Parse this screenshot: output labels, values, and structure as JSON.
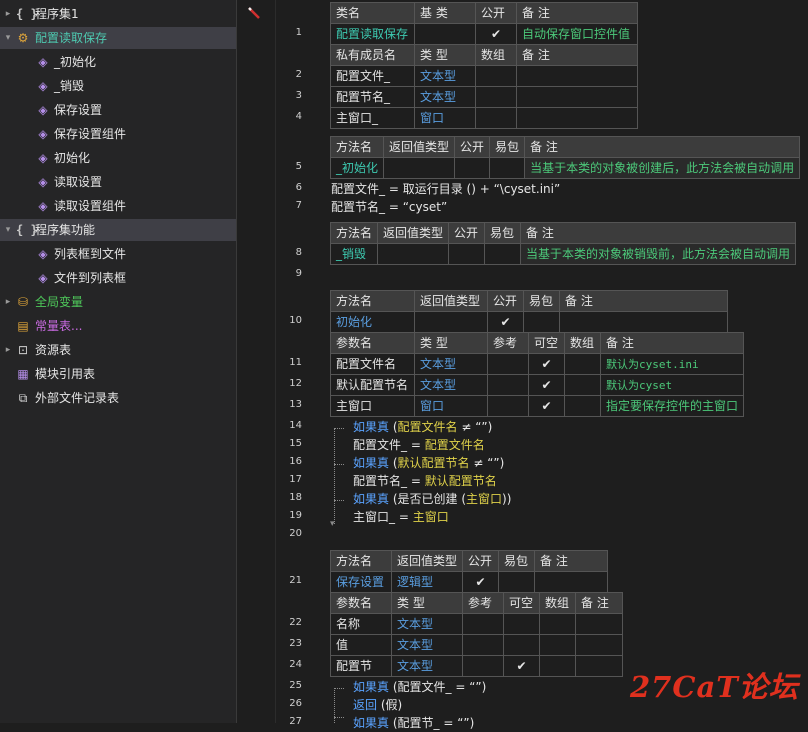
{
  "sidebar": {
    "items": [
      {
        "label": "程序集1",
        "icon": "braces-icon",
        "arrow": "›"
      },
      {
        "label": "配置读取保存",
        "icon": "gear-class-icon",
        "arrow": "⌄"
      },
      {
        "label": "_初始化",
        "icon": "cube-icon"
      },
      {
        "label": "_销毁",
        "icon": "cube-icon"
      },
      {
        "label": "保存设置",
        "icon": "cube-icon"
      },
      {
        "label": "保存设置组件",
        "icon": "cube-icon"
      },
      {
        "label": "初始化",
        "icon": "cube-icon"
      },
      {
        "label": "读取设置",
        "icon": "cube-icon"
      },
      {
        "label": "读取设置组件",
        "icon": "cube-icon"
      },
      {
        "label": "程序集功能",
        "icon": "braces-icon",
        "arrow": "⌄"
      },
      {
        "label": "列表框到文件",
        "icon": "cube-icon"
      },
      {
        "label": "文件到列表框",
        "icon": "cube-icon"
      },
      {
        "label": "全局变量",
        "icon": "database-icon",
        "arrow": "›"
      },
      {
        "label": "常量表...",
        "icon": "grid-icon"
      },
      {
        "label": "资源表",
        "icon": "resource-icon",
        "arrow": "›"
      },
      {
        "label": "模块引用表",
        "icon": "module-icon"
      },
      {
        "label": "外部文件记录表",
        "icon": "file-icon"
      }
    ]
  },
  "line_numbers": [
    "1",
    "2",
    "3",
    "4",
    "5",
    "6",
    "7",
    "8",
    "9",
    "10",
    "11",
    "12",
    "13",
    "14",
    "15",
    "16",
    "17",
    "18",
    "19",
    "20",
    "21",
    "22",
    "23",
    "24",
    "25",
    "26",
    "27"
  ],
  "class_table": {
    "headers": [
      "类名",
      "基 类",
      "公开",
      "备 注"
    ],
    "row": [
      "配置读取保存",
      "",
      "✔",
      "自动保存窗口控件值"
    ],
    "member_headers": [
      "私有成员名",
      "类 型",
      "数组",
      "备 注"
    ],
    "members": [
      [
        "配置文件_",
        "文本型",
        "",
        ""
      ],
      [
        "配置节名_",
        "文本型",
        "",
        ""
      ],
      [
        "主窗口_",
        "窗口",
        "",
        ""
      ]
    ]
  },
  "method_init_private": {
    "headers": [
      "方法名",
      "返回值类型",
      "公开",
      "易包",
      "备 注"
    ],
    "row": [
      "_初始化",
      "",
      "",
      "",
      "当基于本类的对象被创建后，此方法会被自动调用"
    ]
  },
  "code_line6": {
    "lhs": "配置文件_",
    "op": " = ",
    "fn": "取运行目录",
    "rest": " () + “\\cyset.ini”"
  },
  "code_line7": {
    "lhs": "配置节名_",
    "op": " = ",
    "rest": "“cyset”"
  },
  "method_destroy": {
    "headers": [
      "方法名",
      "返回值类型",
      "公开",
      "易包",
      "备 注"
    ],
    "row": [
      "_销毁",
      "",
      "",
      "",
      "当基于本类的对象被销毁前，此方法会被自动调用"
    ]
  },
  "method_init": {
    "headers": [
      "方法名",
      "返回值类型",
      "公开",
      "易包",
      "备 注"
    ],
    "row": [
      "初始化",
      "",
      "✔",
      "",
      ""
    ],
    "param_headers": [
      "参数名",
      "类 型",
      "参考",
      "可空",
      "数组",
      "备 注"
    ],
    "params": [
      [
        "配置文件名",
        "文本型",
        "",
        "✔",
        "",
        "默认为cyset.ini"
      ],
      [
        "默认配置节名",
        "文本型",
        "",
        "✔",
        "",
        "默认为cyset"
      ],
      [
        "主窗口",
        "窗口",
        "",
        "✔",
        "",
        "指定要保存控件的主窗口"
      ]
    ]
  },
  "code_block_init": {
    "l14": {
      "kw": "如果真",
      "a": " (",
      "v": "配置文件名",
      "b": " ≠ “”)"
    },
    "l15": {
      "lhs": "配置文件_",
      "op": " = ",
      "v": "配置文件名"
    },
    "l16": {
      "kw": "如果真",
      "a": " (",
      "v": "默认配置节名",
      "b": " ≠ “”)"
    },
    "l17": {
      "lhs": "配置节名_",
      "op": " = ",
      "v": "默认配置节名"
    },
    "l18": {
      "kw": "如果真",
      "a": " (",
      "fn": "是否已创建",
      "c": " (",
      "v": "主窗口",
      "b": "))"
    },
    "l19": {
      "lhs": "主窗口_",
      "op": " = ",
      "v": "主窗口"
    }
  },
  "method_save": {
    "headers": [
      "方法名",
      "返回值类型",
      "公开",
      "易包",
      "备 注"
    ],
    "row": [
      "保存设置",
      "逻辑型",
      "✔",
      "",
      ""
    ],
    "param_headers": [
      "参数名",
      "类 型",
      "参考",
      "可空",
      "数组",
      "备 注"
    ],
    "params": [
      [
        "名称",
        "文本型",
        "",
        "",
        "",
        ""
      ],
      [
        "值",
        "文本型",
        "",
        "",
        "",
        ""
      ],
      [
        "配置节",
        "文本型",
        "",
        "✔",
        "",
        ""
      ]
    ]
  },
  "code_block_save": {
    "l25": {
      "kw": "如果真",
      "a": " (",
      "v": "配置文件_",
      "b": " = “”)"
    },
    "l26": {
      "kw": "返回",
      "a": " (",
      "v": "假",
      "b": ")"
    },
    "l27": {
      "kw": "如果真",
      "a": " (",
      "v": "配置节_",
      "b": " = “”)"
    }
  },
  "watermark": "27CaT论坛",
  "colors": {
    "keyword": "#5aa3ff",
    "variable": "#e0d24a",
    "type": "#5a9ee0",
    "note": "#c9c23c",
    "check": "#e6e63c",
    "watermark": "#e0301e"
  }
}
